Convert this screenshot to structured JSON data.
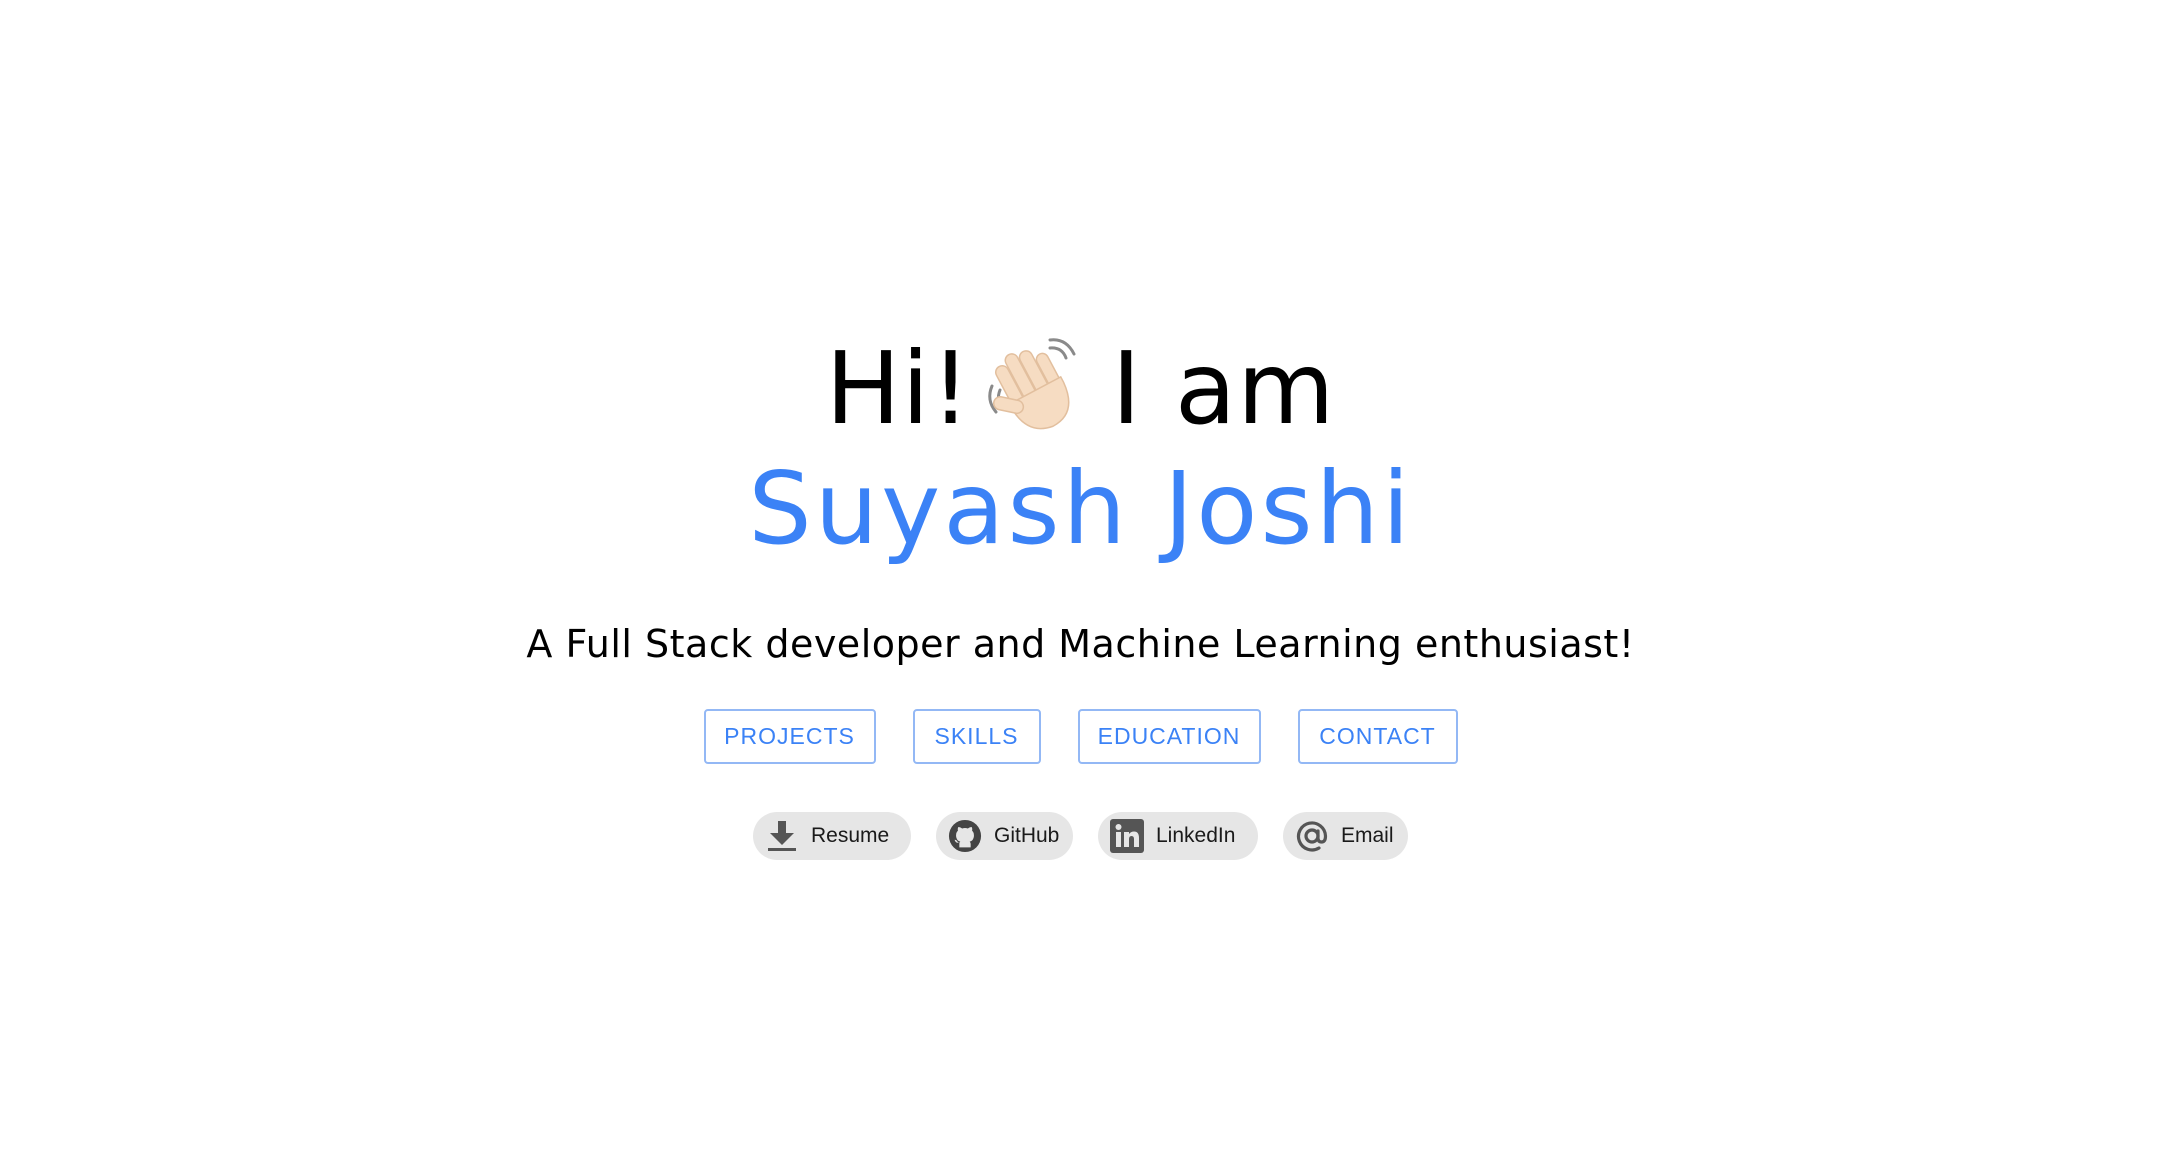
{
  "hero": {
    "greeting_hi": "Hi!",
    "greeting_rest": "I am",
    "name": "Suyash Joshi",
    "tagline": "A Full Stack developer and Machine Learning enthusiast!"
  },
  "nav": {
    "projects": "PROJECTS",
    "skills": "SKILLS",
    "education": "EDUCATION",
    "contact": "CONTACT"
  },
  "links": {
    "resume": {
      "label": "Resume",
      "icon": "download-icon"
    },
    "github": {
      "label": "GitHub",
      "icon": "github-icon"
    },
    "linkedin": {
      "label": "LinkedIn",
      "icon": "linkedin-icon"
    },
    "email": {
      "label": "Email",
      "icon": "at-sign-icon"
    }
  },
  "colors": {
    "accent": "#3b82f6",
    "chip_background": "#e6e6e6",
    "button_border": "#93b8f5"
  }
}
